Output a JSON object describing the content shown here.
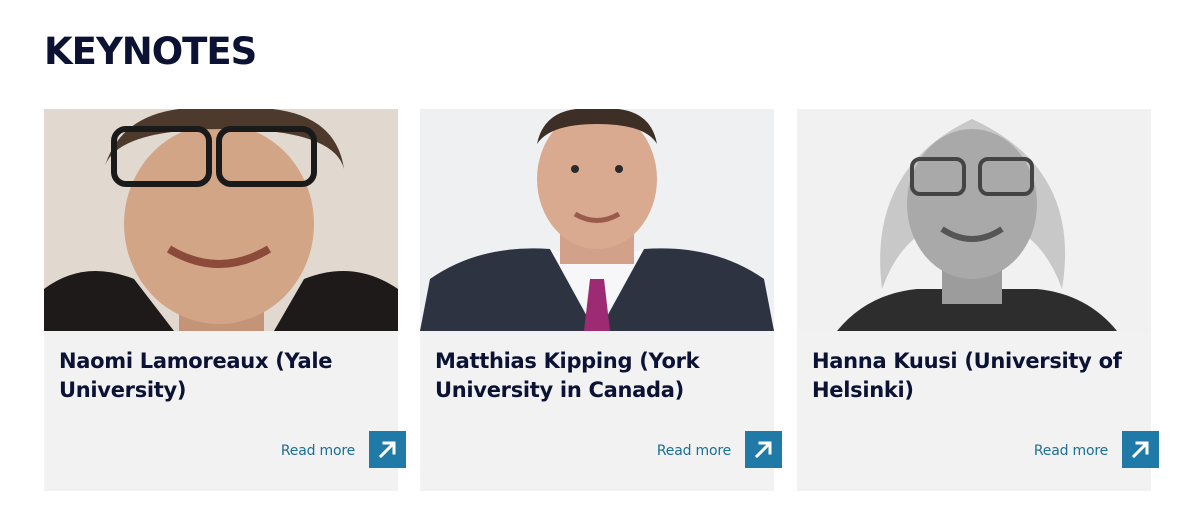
{
  "section": {
    "title": "KEYNOTES"
  },
  "keynotes": [
    {
      "name": "Naomi Lamoreaux (Yale University)",
      "read_more_label": "Read more",
      "photo_icon": "portrait-photo"
    },
    {
      "name": "Matthias Kipping (York University in Canada)",
      "read_more_label": "Read more",
      "photo_icon": "portrait-photo"
    },
    {
      "name": "Hanna Kuusi (University of Helsinki)",
      "read_more_label": "Read more",
      "photo_icon": "portrait-photo"
    }
  ],
  "colors": {
    "title": "#0b1234",
    "card_bg": "#f2f2f2",
    "link": "#1b6f96",
    "button": "#1f7aa8"
  }
}
